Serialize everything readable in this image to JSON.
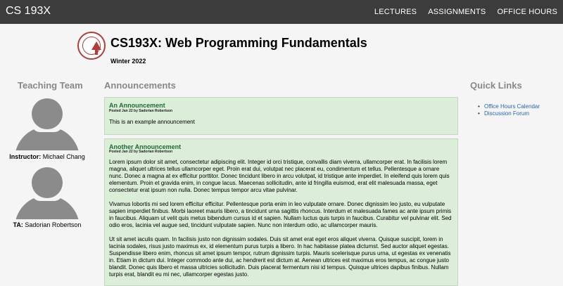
{
  "nav": {
    "brand": "CS 193X",
    "items": [
      "LECTURES",
      "ASSIGNMENTS",
      "OFFICE HOURS"
    ]
  },
  "header": {
    "title": "CS193X: Web Programming Fundamentals",
    "term": "Winter 2022"
  },
  "team": {
    "heading": "Teaching Team",
    "members": [
      {
        "role": "Instructor:",
        "name": "Michael Chang"
      },
      {
        "role": "TA:",
        "name": "Sadorian Robertson"
      }
    ]
  },
  "announcements": {
    "heading": "Announcements",
    "items": [
      {
        "title": "An Announcement",
        "meta": "Posted Jan 22 by Sadorian Robertson",
        "paragraphs": [
          "This is an example announcement"
        ]
      },
      {
        "title": "Another Announcement",
        "meta": "Posted Jan 22 by Sadorian Robertson",
        "paragraphs": [
          "Lorem ipsum dolor sit amet, consectetur adipiscing elit. Integer id orci tristique, convallis diam viverra, ullamcorper erat. In facilisis lorem magna, aliquet ultrices tellus ullamcorper eget. Proin erat dui, volutpat nec placerat eu, condimentum et tellus. Pellentesque a ornare nunc. Donec a magna at ex efficitur porttitor. Donec tincidunt libero in arcu volutpat, id tristique ante imperdiet. In eleifend quis lorem quis elementum. Proin et gravida enim, in congue lacus. Maecenas sollicitudin, ante id fringilla euismod, erat elit malesuada massa, eget consectetur erat ipsum non nulla. Donec tempus tempor arcu vitae pulvinar.",
          "Vivamus lobortis mi sed lorem efficitur efficitur. Pellentesque porta enim in leo vulputate ornare. Donec dignissim leo justo, eu vulputate sapien imperdiet finibus. Morbi laoreet mauris libero, a tincidunt urna sagittis rhoncus. Interdum et malesuada fames ac ante ipsum primis in faucibus. Aliquam ut velit quis metus bibendum cursus id et sapien. Nullam luctus quis turpis in faucibus. Curabitur vel pulvinar elit. Sed odio eros, lacinia vel augue sed, tincidunt vulputate sapien. Nunc non interdum odio, ac ullamcorper mauris.",
          "Ut sit amet iaculis quam. In facilisis justo non dignissim sodales. Duis sit amet erat eget eros aliquet viverra. Quisque suscipit, lorem in lacinia sodales, risus justo maximus ex, id elementum purus turpis a libero. In hac habitasse platea dictumst. Sed auctor aliquet egestas. Suspendisse libero enim, rhoncus sit amet ipsum tempor, rutrum dignissim turpis. Mauris scelerisque purus urna, ut egestas ex venenatis in. Etiam in dictum dui. Integer commodo ante dui, ac hendrerit est dictum at. Aenean ultrices est maximus eros tempus, ac congue justo blandit. Donec quis libero et massa ultricies sollicitudin. Duis placerat fermentum nisi id tempus. Quisque ultrices dapibus finibus. Nullam turpis erat, blandit eu mi nec, ullamcorper egestas justo."
        ]
      }
    ]
  },
  "quick_links": {
    "heading": "Quick Links",
    "items": [
      "Office Hours Calendar",
      "Discussion Forum"
    ]
  },
  "colors": {
    "topbar": "#3c3c3c",
    "card_bg": "#dbeed8",
    "card_title": "#1e6b34",
    "link": "#2666b5",
    "seal": "#b23b3b"
  }
}
